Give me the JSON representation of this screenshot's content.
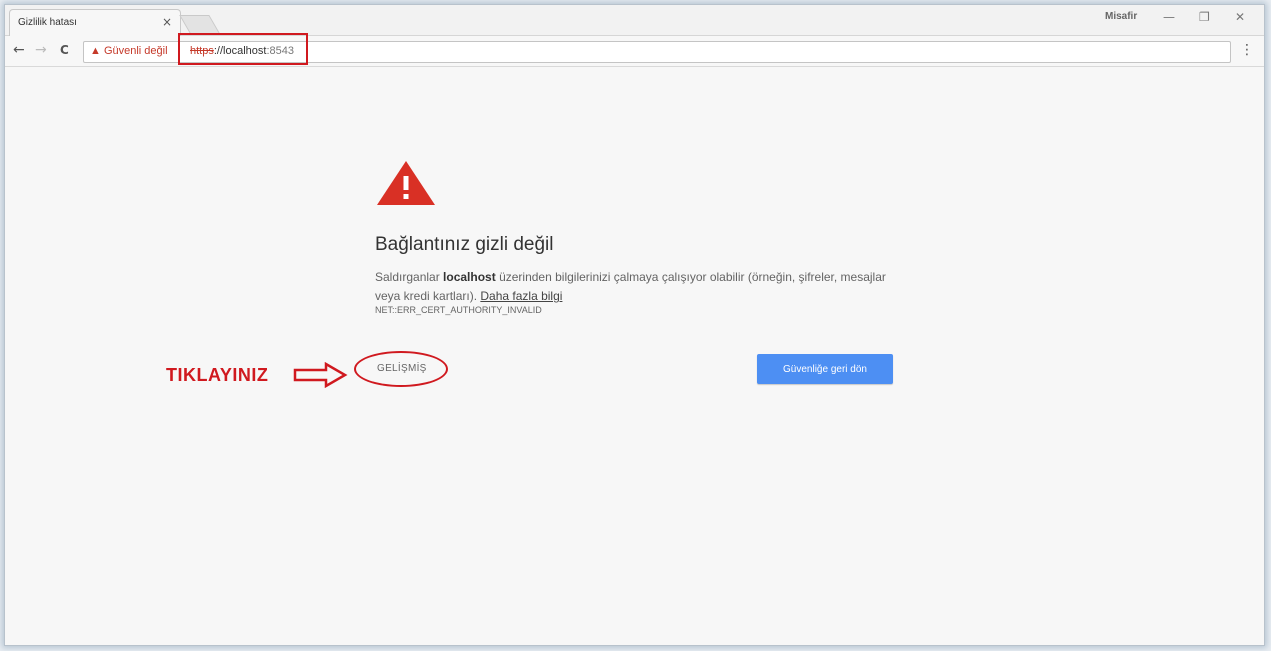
{
  "tab": {
    "title": "Gizlilik hatası",
    "close": "×"
  },
  "window": {
    "profile": "Misafir",
    "minimize": "—",
    "restore": "❐",
    "close": "✕"
  },
  "toolbar": {
    "back": "←",
    "forward": "→",
    "reload": "C",
    "security_label": "▲ Güvenli değil",
    "url_scheme": "https",
    "url_rest": "://localhost",
    "url_port": ":8543",
    "menu": "⋮"
  },
  "page": {
    "heading": "Bağlantınız gizli değil",
    "desc_part1": "Saldırganlar ",
    "desc_host": "localhost",
    "desc_part2": " üzerinden bilgilerinizi çalmaya çalışıyor olabilir (örneğin, şifreler, mesajlar veya kredi kartları). ",
    "learn_more": "Daha fazla bilgi",
    "error_code": "NET::ERR_CERT_AUTHORITY_INVALID",
    "advanced": "GELİŞMİŞ",
    "back_to_safety": "Güvenliğe geri dön"
  },
  "annotation": {
    "text": "TIKLAYINIZ"
  },
  "colors": {
    "accent": "#4d8ff3",
    "warning": "#d93025",
    "annotation": "#d0191f"
  }
}
